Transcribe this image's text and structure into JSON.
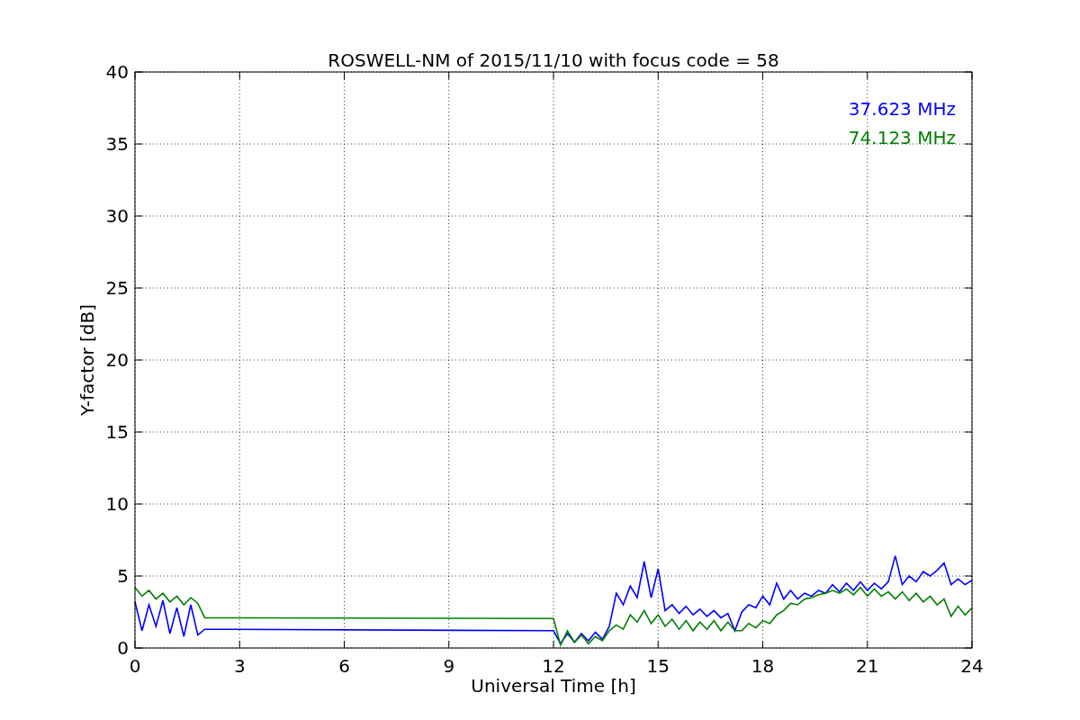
{
  "chart_data": {
    "type": "line",
    "title": "ROSWELL-NM of 2015/11/10 with focus code = 58",
    "xlabel": "Universal Time [h]",
    "ylabel": "Y-factor [dB]",
    "xlim": [
      0,
      24
    ],
    "ylim": [
      0,
      40
    ],
    "xticks": [
      0,
      3,
      6,
      9,
      12,
      15,
      18,
      21,
      24
    ],
    "yticks": [
      0,
      5,
      10,
      15,
      20,
      25,
      30,
      35,
      40
    ],
    "grid": true,
    "x": [
      0,
      0.2,
      0.4,
      0.6,
      0.8,
      1,
      1.2,
      1.4,
      1.6,
      1.8,
      2,
      12,
      12.2,
      12.4,
      12.6,
      12.8,
      13,
      13.2,
      13.4,
      13.6,
      13.8,
      14,
      14.2,
      14.4,
      14.6,
      14.8,
      15,
      15.2,
      15.4,
      15.6,
      15.8,
      16,
      16.2,
      16.4,
      16.6,
      16.8,
      17,
      17.2,
      17.4,
      17.6,
      17.8,
      18,
      18.2,
      18.4,
      18.6,
      18.8,
      19,
      19.2,
      19.4,
      19.6,
      19.8,
      20,
      20.2,
      20.4,
      20.6,
      20.8,
      21,
      21.2,
      21.4,
      21.6,
      21.8,
      22,
      22.2,
      22.4,
      22.6,
      22.8,
      23,
      23.2,
      23.4,
      23.6,
      23.8,
      24
    ],
    "series": [
      {
        "name": "37.623 MHz",
        "color": "#0000ff",
        "values": [
          3.2,
          1.2,
          3.0,
          1.5,
          3.3,
          1.0,
          2.8,
          0.8,
          3.0,
          0.9,
          1.3,
          1.2,
          0.3,
          1.0,
          0.4,
          1.0,
          0.5,
          1.1,
          0.6,
          1.5,
          3.8,
          3.0,
          4.3,
          3.5,
          6.0,
          3.5,
          5.5,
          2.6,
          3.0,
          2.4,
          2.9,
          2.3,
          2.7,
          2.2,
          2.6,
          2.1,
          2.4,
          1.2,
          2.5,
          3.0,
          2.8,
          3.6,
          3.0,
          4.5,
          3.4,
          4.0,
          3.4,
          3.8,
          3.6,
          4.0,
          3.8,
          4.4,
          3.9,
          4.5,
          4.0,
          4.6,
          4.0,
          4.5,
          4.1,
          4.6,
          6.4,
          4.4,
          5.0,
          4.6,
          5.3,
          5.0,
          5.4,
          5.9,
          4.4,
          4.8,
          4.4,
          4.7
        ]
      },
      {
        "name": "74.123 MHz",
        "color": "#008000",
        "values": [
          4.2,
          3.6,
          4.0,
          3.4,
          3.8,
          3.2,
          3.6,
          3.0,
          3.5,
          3.1,
          2.1,
          2.05,
          0.2,
          1.2,
          0.4,
          0.9,
          0.3,
          0.8,
          0.5,
          1.2,
          1.6,
          1.3,
          2.3,
          1.8,
          2.6,
          1.7,
          2.3,
          1.5,
          2.0,
          1.3,
          1.9,
          1.2,
          1.8,
          1.3,
          1.9,
          1.2,
          1.8,
          1.2,
          1.2,
          1.7,
          1.4,
          1.9,
          1.7,
          2.3,
          2.6,
          3.1,
          3.0,
          3.4,
          3.5,
          3.7,
          3.8,
          4.0,
          3.8,
          4.1,
          3.7,
          4.2,
          3.6,
          4.1,
          3.6,
          3.9,
          3.4,
          3.9,
          3.3,
          3.8,
          3.2,
          3.6,
          3.0,
          3.4,
          2.2,
          2.9,
          2.3,
          2.8
        ]
      }
    ]
  }
}
